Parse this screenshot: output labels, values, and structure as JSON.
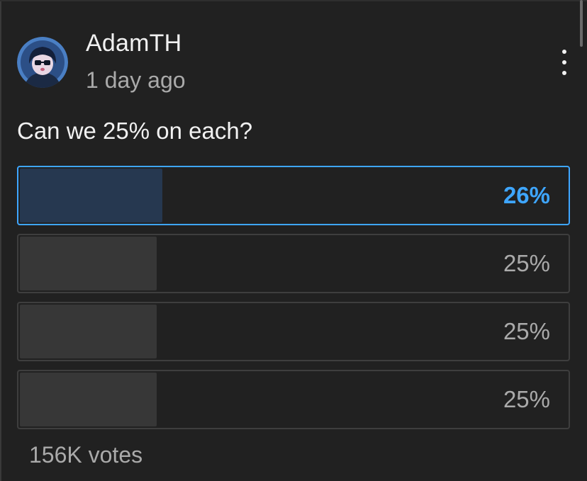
{
  "post": {
    "author": "AdamTH",
    "time": "1 day ago",
    "question": "Can we 25% on each?",
    "votes": "156K votes",
    "menu_icon": "more-vert-icon",
    "avatar_icon": "user-avatar"
  },
  "poll": {
    "options": [
      {
        "label": "26%",
        "value": 0.26,
        "selected": true
      },
      {
        "label": "25%",
        "value": 0.25,
        "selected": false
      },
      {
        "label": "25%",
        "value": 0.25,
        "selected": false
      },
      {
        "label": "25%",
        "value": 0.25,
        "selected": false
      }
    ]
  },
  "colors": {
    "background": "#212121",
    "accent": "#3ea6ff",
    "selected_fill": "#263850",
    "unselected_fill": "#373737",
    "border": "#3e3e3e",
    "secondary_text": "#aaaaaa"
  }
}
